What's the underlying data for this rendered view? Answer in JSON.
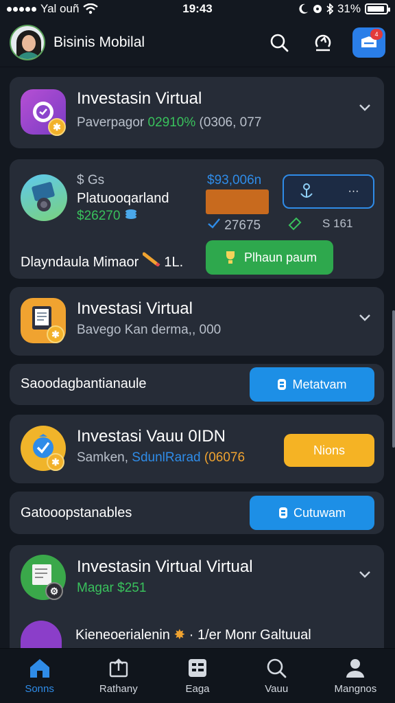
{
  "status_bar": {
    "carrier": "Yal ouñ",
    "time": "19:43",
    "battery_pct": "31%"
  },
  "header": {
    "title": "Bisinis Mobilal",
    "notif_badge": "4"
  },
  "cards": {
    "c1": {
      "title": "Investasin Virtual",
      "sub_a": "Paverpagor",
      "sub_b": "02910%",
      "sub_c": "(0306, 077"
    },
    "c2": {
      "label_a": "$ Gs",
      "name": "Platuooqarland",
      "amount": "$26270",
      "price": "$93,006n",
      "count": "27675",
      "small": "S 161",
      "bottom_label": "Dlayndaula Mimaor",
      "bottom_num": "1L.",
      "action_label": "Plhaun paum",
      "top_button_dots": "···"
    },
    "c3": {
      "title": "Investasi Virtual",
      "sub": "Bavego Kan derma,, 000"
    },
    "r4": {
      "label": "Saoodagbantianaule",
      "button": "Metatvam"
    },
    "c5": {
      "title": "Investasi Vauu 0IDN",
      "sub_a": "Samken,",
      "sub_b": "SdunlRarad",
      "sub_c": "(06076",
      "button": "Nions"
    },
    "r6": {
      "label": "Gatooopstanables",
      "button": "Cutuwam"
    },
    "c7": {
      "title": "Investasin Virtual Virtual",
      "sub": "Magar $251",
      "row2": "Kieneoerialenin",
      "row2_b": "· 1/er Monr Galtuual"
    }
  },
  "nav": {
    "items": [
      {
        "label": "Sonns"
      },
      {
        "label": "Rathany"
      },
      {
        "label": "Eaga"
      },
      {
        "label": "Vauu"
      },
      {
        "label": "Mangnos"
      }
    ]
  },
  "colors": {
    "accent": "#2f8ce8",
    "green": "#39c15c",
    "orange": "#f0a330",
    "card": "#262c37",
    "bg": "#131820"
  }
}
